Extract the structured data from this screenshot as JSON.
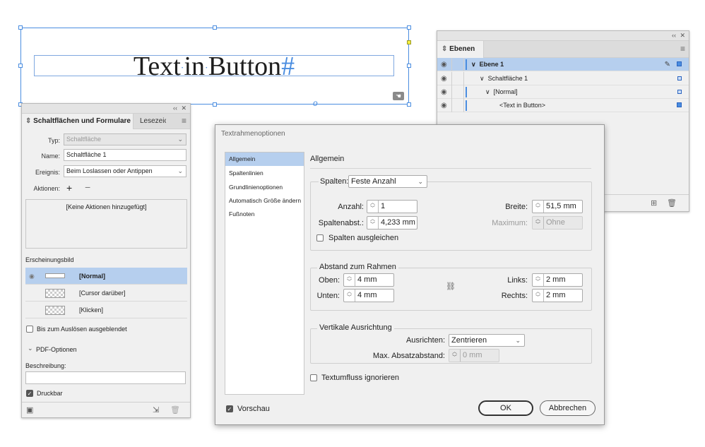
{
  "canvas": {
    "frame_text": "Text·in·Button",
    "frame_text_words": [
      "Text",
      "in",
      "Button"
    ],
    "hidden_char": "#"
  },
  "layers_panel": {
    "tab_label": "Ebenen",
    "rows": [
      {
        "label": "Ebene 1",
        "selected": true
      },
      {
        "label": "Schaltfläche 1",
        "selected": false
      },
      {
        "label": "[Normal]",
        "selected": false
      },
      {
        "label": "<Text in Button>",
        "selected": false
      }
    ]
  },
  "buttons_panel": {
    "tab_active": "Schaltflächen und Formulare",
    "tab_other": "Lesezeic",
    "typ_label": "Typ:",
    "typ_value": "Schaltfläche",
    "name_label": "Name:",
    "name_value": "Schaltfläche 1",
    "event_label": "Ereignis:",
    "event_value": "Beim Loslassen oder Antippen",
    "actions_label": "Aktionen:",
    "actions_empty": "[Keine Aktionen hinzugefügt]",
    "appearance_label": "Erscheinungsbild",
    "appearances": [
      {
        "label": "[Normal]",
        "selected": true
      },
      {
        "label": "[Cursor darüber]",
        "selected": false
      },
      {
        "label": "[Klicken]",
        "selected": false
      }
    ],
    "hidden_until_label": "Bis zum Auslösen ausgeblendet",
    "pdf_options_label": "PDF-Optionen",
    "description_label": "Beschreibung:",
    "description_value": "",
    "printable_label": "Druckbar",
    "printable_checked": true
  },
  "dialog": {
    "title": "Textrahmenoptionen",
    "nav": [
      "Allgemein",
      "Spaltenlinien",
      "Grundlinienoptionen",
      "Automatisch Größe ändern",
      "Fußnoten"
    ],
    "section_title": "Allgemein",
    "columns": {
      "label": "Spalten:",
      "type_value": "Feste Anzahl",
      "count_label": "Anzahl:",
      "count_value": "1",
      "gutter_label": "Spaltenabst.:",
      "gutter_value": "4,233 mm",
      "width_label": "Breite:",
      "width_value": "51,5 mm",
      "max_label": "Maximum:",
      "max_value": "Ohne",
      "balance_label": "Spalten ausgleichen"
    },
    "inset": {
      "title": "Abstand zum Rahmen",
      "top_label": "Oben:",
      "top_value": "4 mm",
      "bottom_label": "Unten:",
      "bottom_value": "4 mm",
      "left_label": "Links:",
      "left_value": "2 mm",
      "right_label": "Rechts:",
      "right_value": "2 mm"
    },
    "vertical": {
      "title": "Vertikale Ausrichtung",
      "align_label": "Ausrichten:",
      "align_value": "Zentrieren",
      "max_spacing_label": "Max. Absatzabstand:",
      "max_spacing_value": "0 mm"
    },
    "ignore_wrap_label": "Textumfluss ignorieren",
    "preview_label": "Vorschau",
    "preview_checked": true,
    "ok_label": "OK",
    "cancel_label": "Abbrechen"
  },
  "colors": {
    "selection": "#b6cfee",
    "frame_blue": "#4a8de0"
  }
}
